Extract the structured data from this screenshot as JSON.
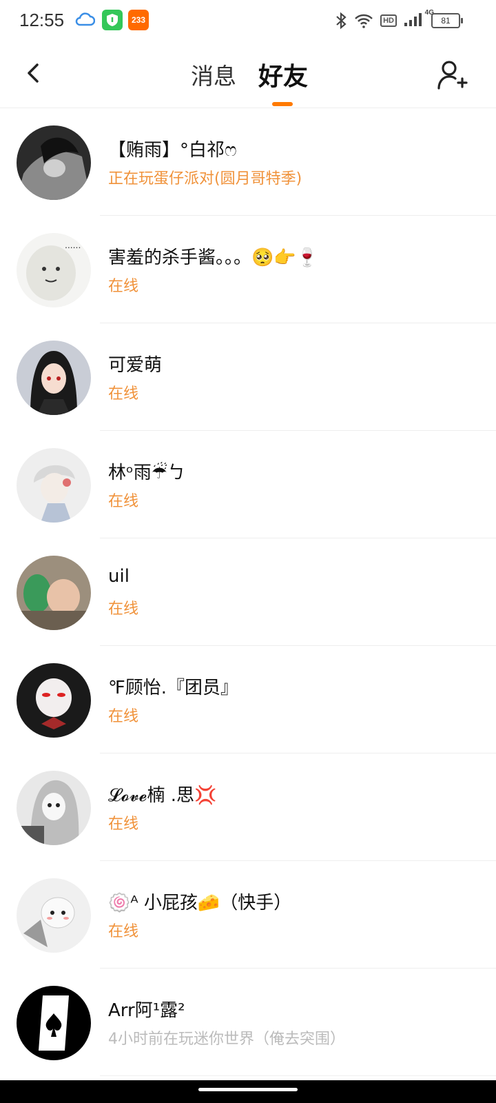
{
  "status_bar": {
    "time": "12:55",
    "app_badge": "233",
    "network": "4G",
    "battery": "81",
    "icons": [
      "cloud-icon",
      "shield-app-icon",
      "app-233-icon",
      "bluetooth-icon",
      "wifi-icon",
      "hd-icon",
      "signal-icon",
      "battery-icon"
    ]
  },
  "header": {
    "tabs": [
      {
        "label": "消息",
        "active": false
      },
      {
        "label": "好友",
        "active": true
      }
    ],
    "accent_color": "#ff7a00"
  },
  "friends": [
    {
      "name": "【贿雨】°白祁ෆ",
      "status": "正在玩蛋仔派对(圆月哥特季)",
      "online": true
    },
    {
      "name": "害羞的杀手酱。。。🥺👉🍷",
      "status": "在线",
      "online": true
    },
    {
      "name": "可爱萌",
      "status": "在线",
      "online": true
    },
    {
      "name": "林ᵒ雨☔ㄅ",
      "status": "在线",
      "online": true
    },
    {
      "name": "uil",
      "status": "在线",
      "online": true
    },
    {
      "name": "℉顾怡.『团员』",
      "status": "在线",
      "online": true
    },
    {
      "name": "𝓛𝓸𝓿𝓮楠 .思💢",
      "status": "在线",
      "online": true
    },
    {
      "name": "🍥ᴬ 小屁孩🧀（快手）",
      "status": "在线",
      "online": true
    },
    {
      "name": "Arr阿¹露²",
      "status": "4小时前在玩迷你世界（俺去突围）",
      "online": false
    }
  ],
  "colors": {
    "online_status": "#f0923a",
    "offline_status": "#bbbbbb"
  }
}
